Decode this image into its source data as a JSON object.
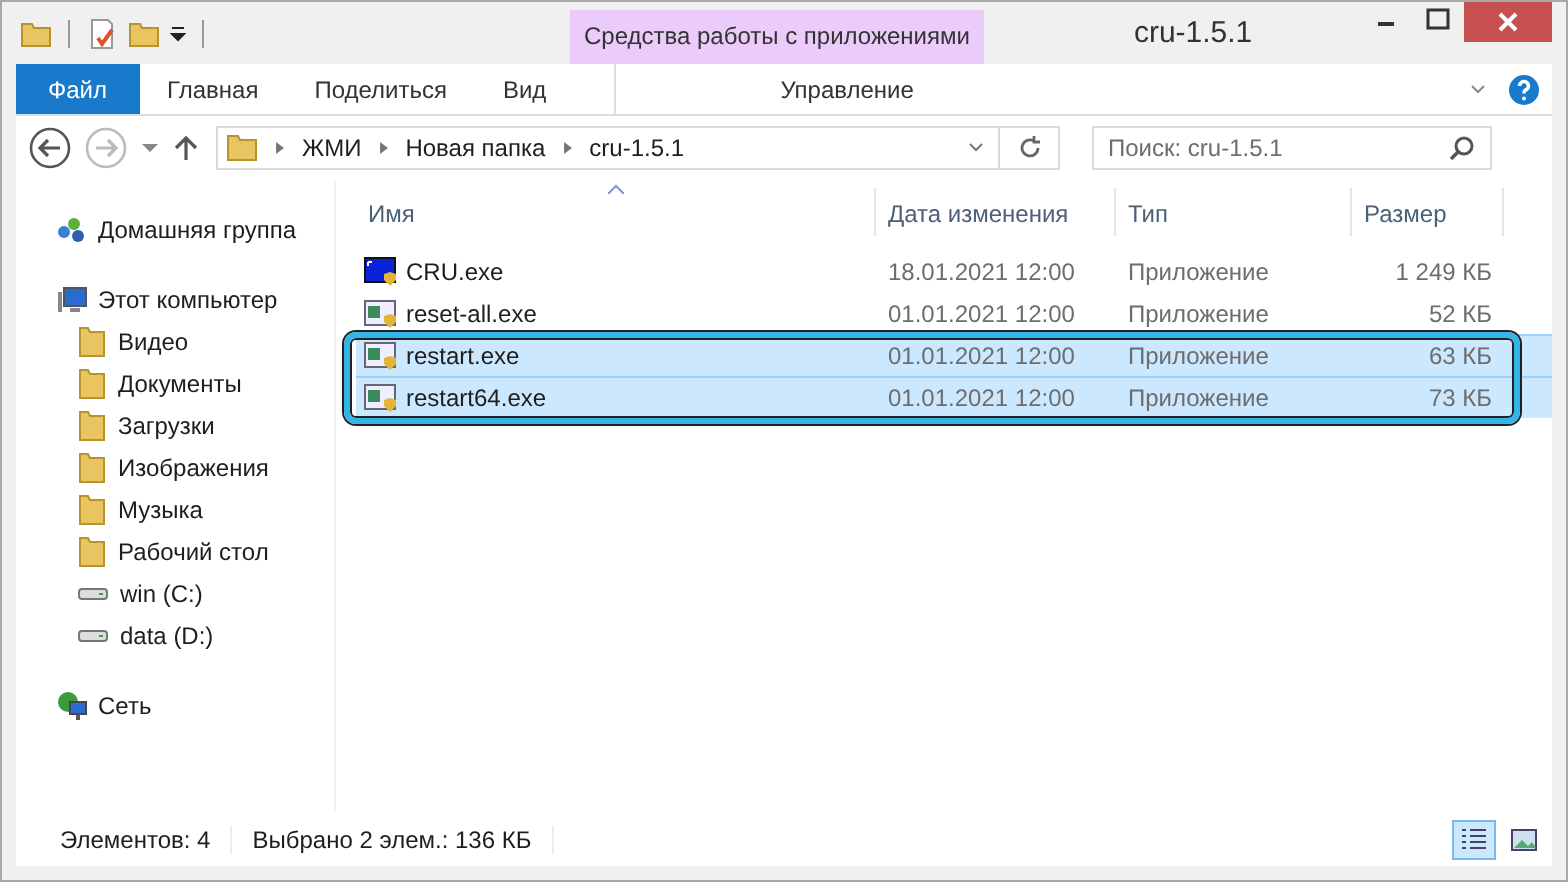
{
  "window": {
    "title": "cru-1.5.1",
    "context_group": "Средства работы с приложениями"
  },
  "ribbon_tabs": [
    {
      "label": "Файл",
      "kind": "file",
      "selected": false
    },
    {
      "label": "Главная",
      "kind": "plain",
      "selected": false
    },
    {
      "label": "Поделиться",
      "kind": "plain",
      "selected": false
    },
    {
      "label": "Вид",
      "kind": "plain",
      "selected": false
    },
    {
      "label": "Управление",
      "kind": "context",
      "selected": false
    }
  ],
  "address": {
    "path": [
      "ЖМИ",
      "Новая папка",
      "cru-1.5.1"
    ]
  },
  "search": {
    "placeholder": "Поиск: cru-1.5.1"
  },
  "navigation": [
    {
      "label": "Домашняя группа",
      "kind": "homegroup"
    },
    {
      "label": "Этот компьютер",
      "kind": "computer",
      "children": [
        {
          "label": "Видео",
          "kind": "folder"
        },
        {
          "label": "Документы",
          "kind": "folder"
        },
        {
          "label": "Загрузки",
          "kind": "folder"
        },
        {
          "label": "Изображения",
          "kind": "folder"
        },
        {
          "label": "Музыка",
          "kind": "folder"
        },
        {
          "label": "Рабочий стол",
          "kind": "folder"
        },
        {
          "label": "win (C:)",
          "kind": "drive"
        },
        {
          "label": "data (D:)",
          "kind": "drive"
        }
      ]
    },
    {
      "label": "Сеть",
      "kind": "network"
    }
  ],
  "table": {
    "columns": [
      "Имя",
      "Дата изменения",
      "Тип",
      "Размер"
    ],
    "rows": [
      {
        "name": "CRU.exe",
        "date": "18.01.2021 12:00",
        "type": "Приложение",
        "size": "1 249 КБ",
        "kind": "monitor",
        "selected": false
      },
      {
        "name": "reset-all.exe",
        "date": "01.01.2021 12:00",
        "type": "Приложение",
        "size": "52 КБ",
        "kind": "app",
        "selected": false
      },
      {
        "name": "restart.exe",
        "date": "01.01.2021 12:00",
        "type": "Приложение",
        "size": "63 КБ",
        "kind": "app",
        "selected": true
      },
      {
        "name": "restart64.exe",
        "date": "01.01.2021 12:00",
        "type": "Приложение",
        "size": "73 КБ",
        "kind": "app",
        "selected": true
      }
    ]
  },
  "status_bar": {
    "items": [
      "Элементов: 4",
      "Выбрано 2 элем.: 136 КБ"
    ],
    "views": [
      {
        "kind": "details",
        "selected": true
      },
      {
        "kind": "large",
        "selected": false
      }
    ]
  }
}
